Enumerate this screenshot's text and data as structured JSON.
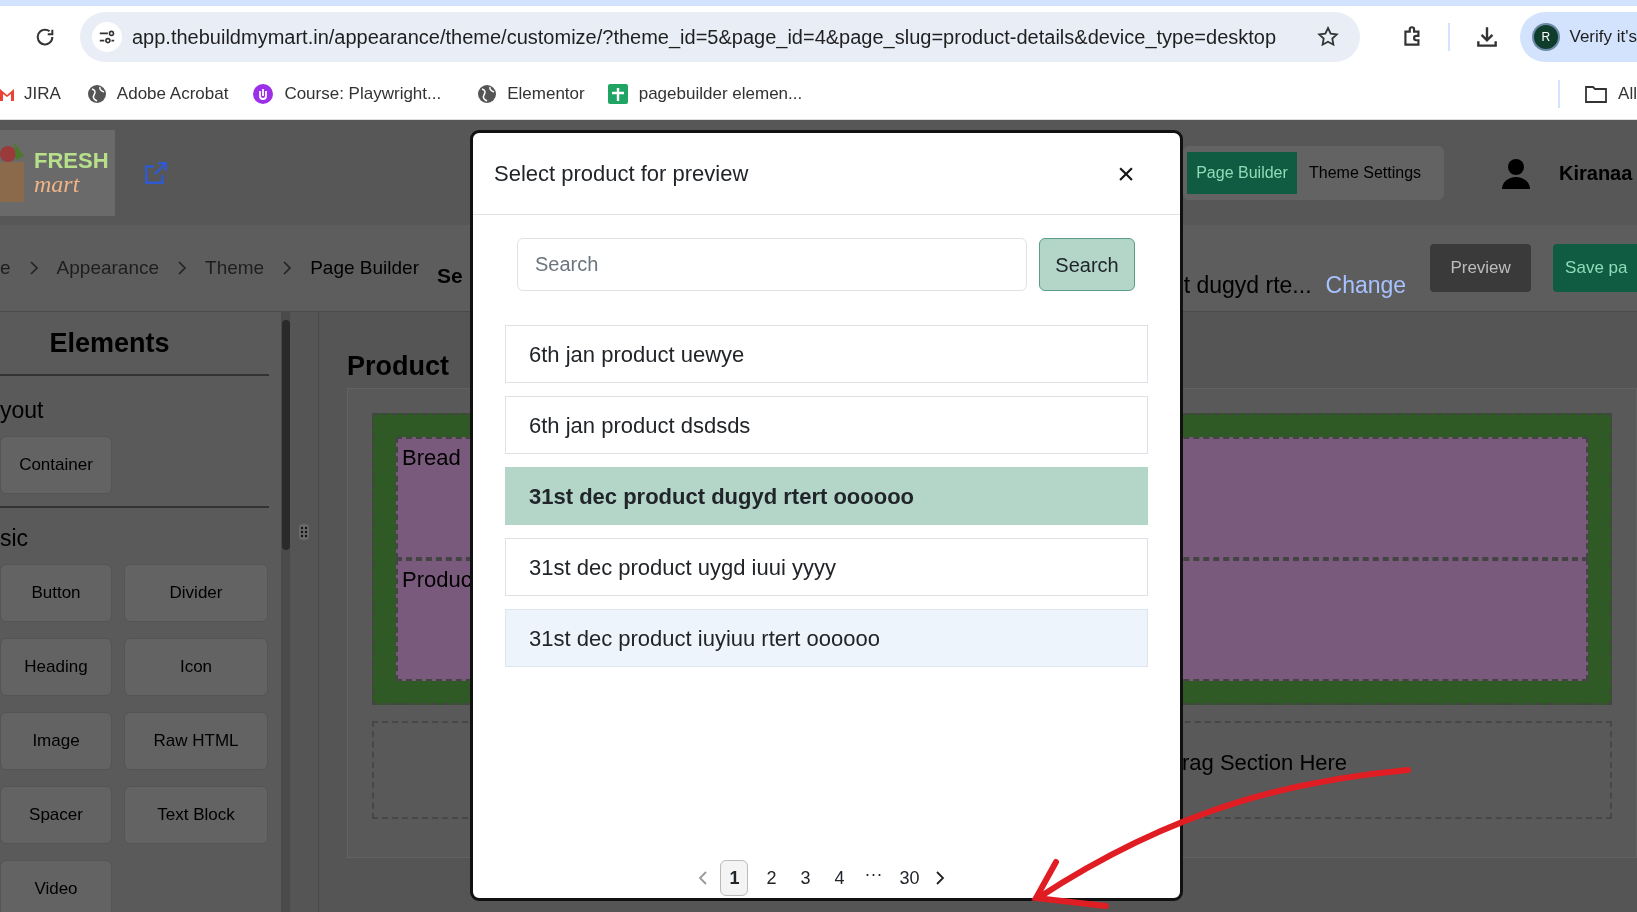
{
  "browser": {
    "url": "app.thebuildmymart.in/appearance/theme/customize/?theme_id=5&page_id=4&page_slug=product-details&device_type=desktop",
    "avatar_letter": "R",
    "profile_label": "Verify it's",
    "bookmarks": [
      {
        "label": "JIRA",
        "kind": "gmail"
      },
      {
        "label": "Adobe Acrobat",
        "kind": "globe"
      },
      {
        "label": "Course: Playwright...",
        "kind": "course"
      },
      {
        "label": "Elementor",
        "kind": "globe"
      },
      {
        "label": "pagebuilder elemen...",
        "kind": "sheet"
      }
    ],
    "all_bookmarks": "All"
  },
  "header": {
    "logo": [
      "FRESH",
      "mart"
    ],
    "tabs": [
      {
        "label": "Page Builder",
        "selected": true
      },
      {
        "label": "Theme Settings",
        "selected": false
      }
    ],
    "user": "Kiranaa"
  },
  "breadcrumb": [
    "e",
    "Appearance",
    "Theme",
    "Page Builder"
  ],
  "breadcrumb_tail": "Se",
  "product_bar": {
    "product": "t dugyd rte...",
    "change": "Change",
    "preview": "Preview",
    "save": "Save pa"
  },
  "sidebar": {
    "title": "Elements",
    "groups": [
      {
        "title": "yout",
        "items": [
          "Container"
        ]
      },
      {
        "title": "sic",
        "items": [
          "Button",
          "Divider",
          "Heading",
          "Icon",
          "Image",
          "Raw HTML",
          "Spacer",
          "Text Block",
          "Video"
        ]
      }
    ]
  },
  "canvas": {
    "title": "Product",
    "blocks": [
      "Bread",
      "Produc"
    ],
    "drop_hint": "rag Section Here"
  },
  "modal": {
    "title": "Select product for preview",
    "close": "×",
    "search": {
      "placeholder": "Search"
    },
    "search_button": "Search",
    "products": [
      {
        "name": "6th jan product uewye",
        "selected": false,
        "hovered": false
      },
      {
        "name": "6th jan product dsdsds",
        "selected": false,
        "hovered": false
      },
      {
        "name": "31st dec product dugyd rtert oooooo",
        "selected": true,
        "hovered": false
      },
      {
        "name": "31st dec product uygd iuui yyyy",
        "selected": false,
        "hovered": false
      },
      {
        "name": "31st dec product iuyiuu rtert oooooo",
        "selected": false,
        "hovered": true
      }
    ],
    "pagination": [
      {
        "label": "1",
        "kind": "page",
        "selected": true
      },
      {
        "label": "2",
        "kind": "page",
        "selected": false
      },
      {
        "label": "3",
        "kind": "page",
        "selected": false
      },
      {
        "label": "4",
        "kind": "page",
        "selected": false
      },
      {
        "label": "···",
        "kind": "gap"
      },
      {
        "label": "30",
        "kind": "page",
        "selected": false
      }
    ]
  }
}
